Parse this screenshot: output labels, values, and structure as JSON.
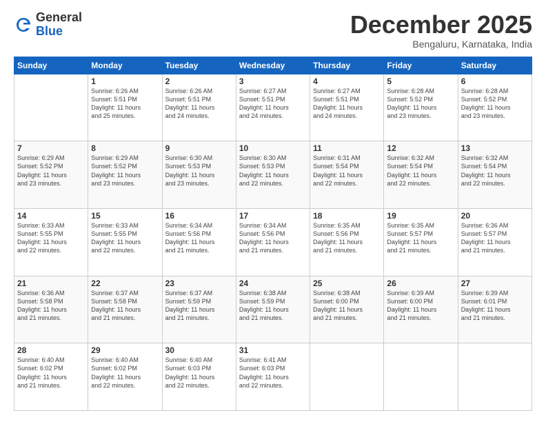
{
  "logo": {
    "line1": "General",
    "line2": "Blue"
  },
  "title": "December 2025",
  "location": "Bengaluru, Karnataka, India",
  "days_of_week": [
    "Sunday",
    "Monday",
    "Tuesday",
    "Wednesday",
    "Thursday",
    "Friday",
    "Saturday"
  ],
  "weeks": [
    [
      {
        "day": "",
        "info": ""
      },
      {
        "day": "1",
        "info": "Sunrise: 6:26 AM\nSunset: 5:51 PM\nDaylight: 11 hours\nand 25 minutes."
      },
      {
        "day": "2",
        "info": "Sunrise: 6:26 AM\nSunset: 5:51 PM\nDaylight: 11 hours\nand 24 minutes."
      },
      {
        "day": "3",
        "info": "Sunrise: 6:27 AM\nSunset: 5:51 PM\nDaylight: 11 hours\nand 24 minutes."
      },
      {
        "day": "4",
        "info": "Sunrise: 6:27 AM\nSunset: 5:51 PM\nDaylight: 11 hours\nand 24 minutes."
      },
      {
        "day": "5",
        "info": "Sunrise: 6:28 AM\nSunset: 5:52 PM\nDaylight: 11 hours\nand 23 minutes."
      },
      {
        "day": "6",
        "info": "Sunrise: 6:28 AM\nSunset: 5:52 PM\nDaylight: 11 hours\nand 23 minutes."
      }
    ],
    [
      {
        "day": "7",
        "info": "Sunrise: 6:29 AM\nSunset: 5:52 PM\nDaylight: 11 hours\nand 23 minutes."
      },
      {
        "day": "8",
        "info": "Sunrise: 6:29 AM\nSunset: 5:52 PM\nDaylight: 11 hours\nand 23 minutes."
      },
      {
        "day": "9",
        "info": "Sunrise: 6:30 AM\nSunset: 5:53 PM\nDaylight: 11 hours\nand 23 minutes."
      },
      {
        "day": "10",
        "info": "Sunrise: 6:30 AM\nSunset: 5:53 PM\nDaylight: 11 hours\nand 22 minutes."
      },
      {
        "day": "11",
        "info": "Sunrise: 6:31 AM\nSunset: 5:54 PM\nDaylight: 11 hours\nand 22 minutes."
      },
      {
        "day": "12",
        "info": "Sunrise: 6:32 AM\nSunset: 5:54 PM\nDaylight: 11 hours\nand 22 minutes."
      },
      {
        "day": "13",
        "info": "Sunrise: 6:32 AM\nSunset: 5:54 PM\nDaylight: 11 hours\nand 22 minutes."
      }
    ],
    [
      {
        "day": "14",
        "info": "Sunrise: 6:33 AM\nSunset: 5:55 PM\nDaylight: 11 hours\nand 22 minutes."
      },
      {
        "day": "15",
        "info": "Sunrise: 6:33 AM\nSunset: 5:55 PM\nDaylight: 11 hours\nand 22 minutes."
      },
      {
        "day": "16",
        "info": "Sunrise: 6:34 AM\nSunset: 5:56 PM\nDaylight: 11 hours\nand 21 minutes."
      },
      {
        "day": "17",
        "info": "Sunrise: 6:34 AM\nSunset: 5:56 PM\nDaylight: 11 hours\nand 21 minutes."
      },
      {
        "day": "18",
        "info": "Sunrise: 6:35 AM\nSunset: 5:56 PM\nDaylight: 11 hours\nand 21 minutes."
      },
      {
        "day": "19",
        "info": "Sunrise: 6:35 AM\nSunset: 5:57 PM\nDaylight: 11 hours\nand 21 minutes."
      },
      {
        "day": "20",
        "info": "Sunrise: 6:36 AM\nSunset: 5:57 PM\nDaylight: 11 hours\nand 21 minutes."
      }
    ],
    [
      {
        "day": "21",
        "info": "Sunrise: 6:36 AM\nSunset: 5:58 PM\nDaylight: 11 hours\nand 21 minutes."
      },
      {
        "day": "22",
        "info": "Sunrise: 6:37 AM\nSunset: 5:58 PM\nDaylight: 11 hours\nand 21 minutes."
      },
      {
        "day": "23",
        "info": "Sunrise: 6:37 AM\nSunset: 5:59 PM\nDaylight: 11 hours\nand 21 minutes."
      },
      {
        "day": "24",
        "info": "Sunrise: 6:38 AM\nSunset: 5:59 PM\nDaylight: 11 hours\nand 21 minutes."
      },
      {
        "day": "25",
        "info": "Sunrise: 6:38 AM\nSunset: 6:00 PM\nDaylight: 11 hours\nand 21 minutes."
      },
      {
        "day": "26",
        "info": "Sunrise: 6:39 AM\nSunset: 6:00 PM\nDaylight: 11 hours\nand 21 minutes."
      },
      {
        "day": "27",
        "info": "Sunrise: 6:39 AM\nSunset: 6:01 PM\nDaylight: 11 hours\nand 21 minutes."
      }
    ],
    [
      {
        "day": "28",
        "info": "Sunrise: 6:40 AM\nSunset: 6:02 PM\nDaylight: 11 hours\nand 21 minutes."
      },
      {
        "day": "29",
        "info": "Sunrise: 6:40 AM\nSunset: 6:02 PM\nDaylight: 11 hours\nand 22 minutes."
      },
      {
        "day": "30",
        "info": "Sunrise: 6:40 AM\nSunset: 6:03 PM\nDaylight: 11 hours\nand 22 minutes."
      },
      {
        "day": "31",
        "info": "Sunrise: 6:41 AM\nSunset: 6:03 PM\nDaylight: 11 hours\nand 22 minutes."
      },
      {
        "day": "",
        "info": ""
      },
      {
        "day": "",
        "info": ""
      },
      {
        "day": "",
        "info": ""
      }
    ]
  ]
}
